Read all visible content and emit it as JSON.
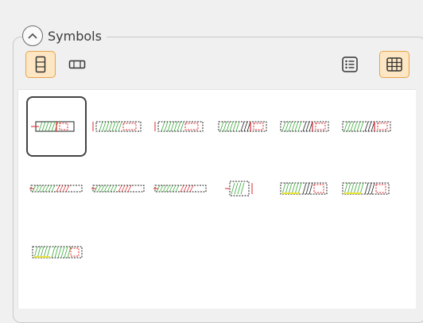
{
  "group": {
    "title": "Symbols",
    "collapse_icon": "chevron-up-icon"
  },
  "toolbar": {
    "portrait_view": {
      "icon": "portrait-layout-icon",
      "active": true
    },
    "landscape_view": {
      "icon": "landscape-layout-icon",
      "active": false
    },
    "list_view": {
      "icon": "list-view-icon",
      "active": false
    },
    "grid_view": {
      "icon": "grid-view-icon",
      "active": true
    }
  },
  "colors": {
    "accent_fill": "#fde6c3",
    "accent_border": "#e8a34a",
    "selection_border": "#444444",
    "symbol_red": "#e0262a",
    "symbol_green": "#3aa83a",
    "symbol_yellow": "#e8e23a",
    "symbol_black": "#222222"
  },
  "symbols": [
    {
      "id": "symbol-1",
      "selected": true,
      "style": "a"
    },
    {
      "id": "symbol-2",
      "selected": false,
      "style": "b"
    },
    {
      "id": "symbol-3",
      "selected": false,
      "style": "b"
    },
    {
      "id": "symbol-4",
      "selected": false,
      "style": "c"
    },
    {
      "id": "symbol-5",
      "selected": false,
      "style": "c"
    },
    {
      "id": "symbol-6",
      "selected": false,
      "style": "c"
    },
    {
      "id": "symbol-7",
      "selected": false,
      "style": "d"
    },
    {
      "id": "symbol-8",
      "selected": false,
      "style": "d"
    },
    {
      "id": "symbol-9",
      "selected": false,
      "style": "d"
    },
    {
      "id": "symbol-10",
      "selected": false,
      "style": "e"
    },
    {
      "id": "symbol-11",
      "selected": false,
      "style": "f"
    },
    {
      "id": "symbol-12",
      "selected": false,
      "style": "f"
    },
    {
      "id": "symbol-13",
      "selected": false,
      "style": "g"
    }
  ]
}
